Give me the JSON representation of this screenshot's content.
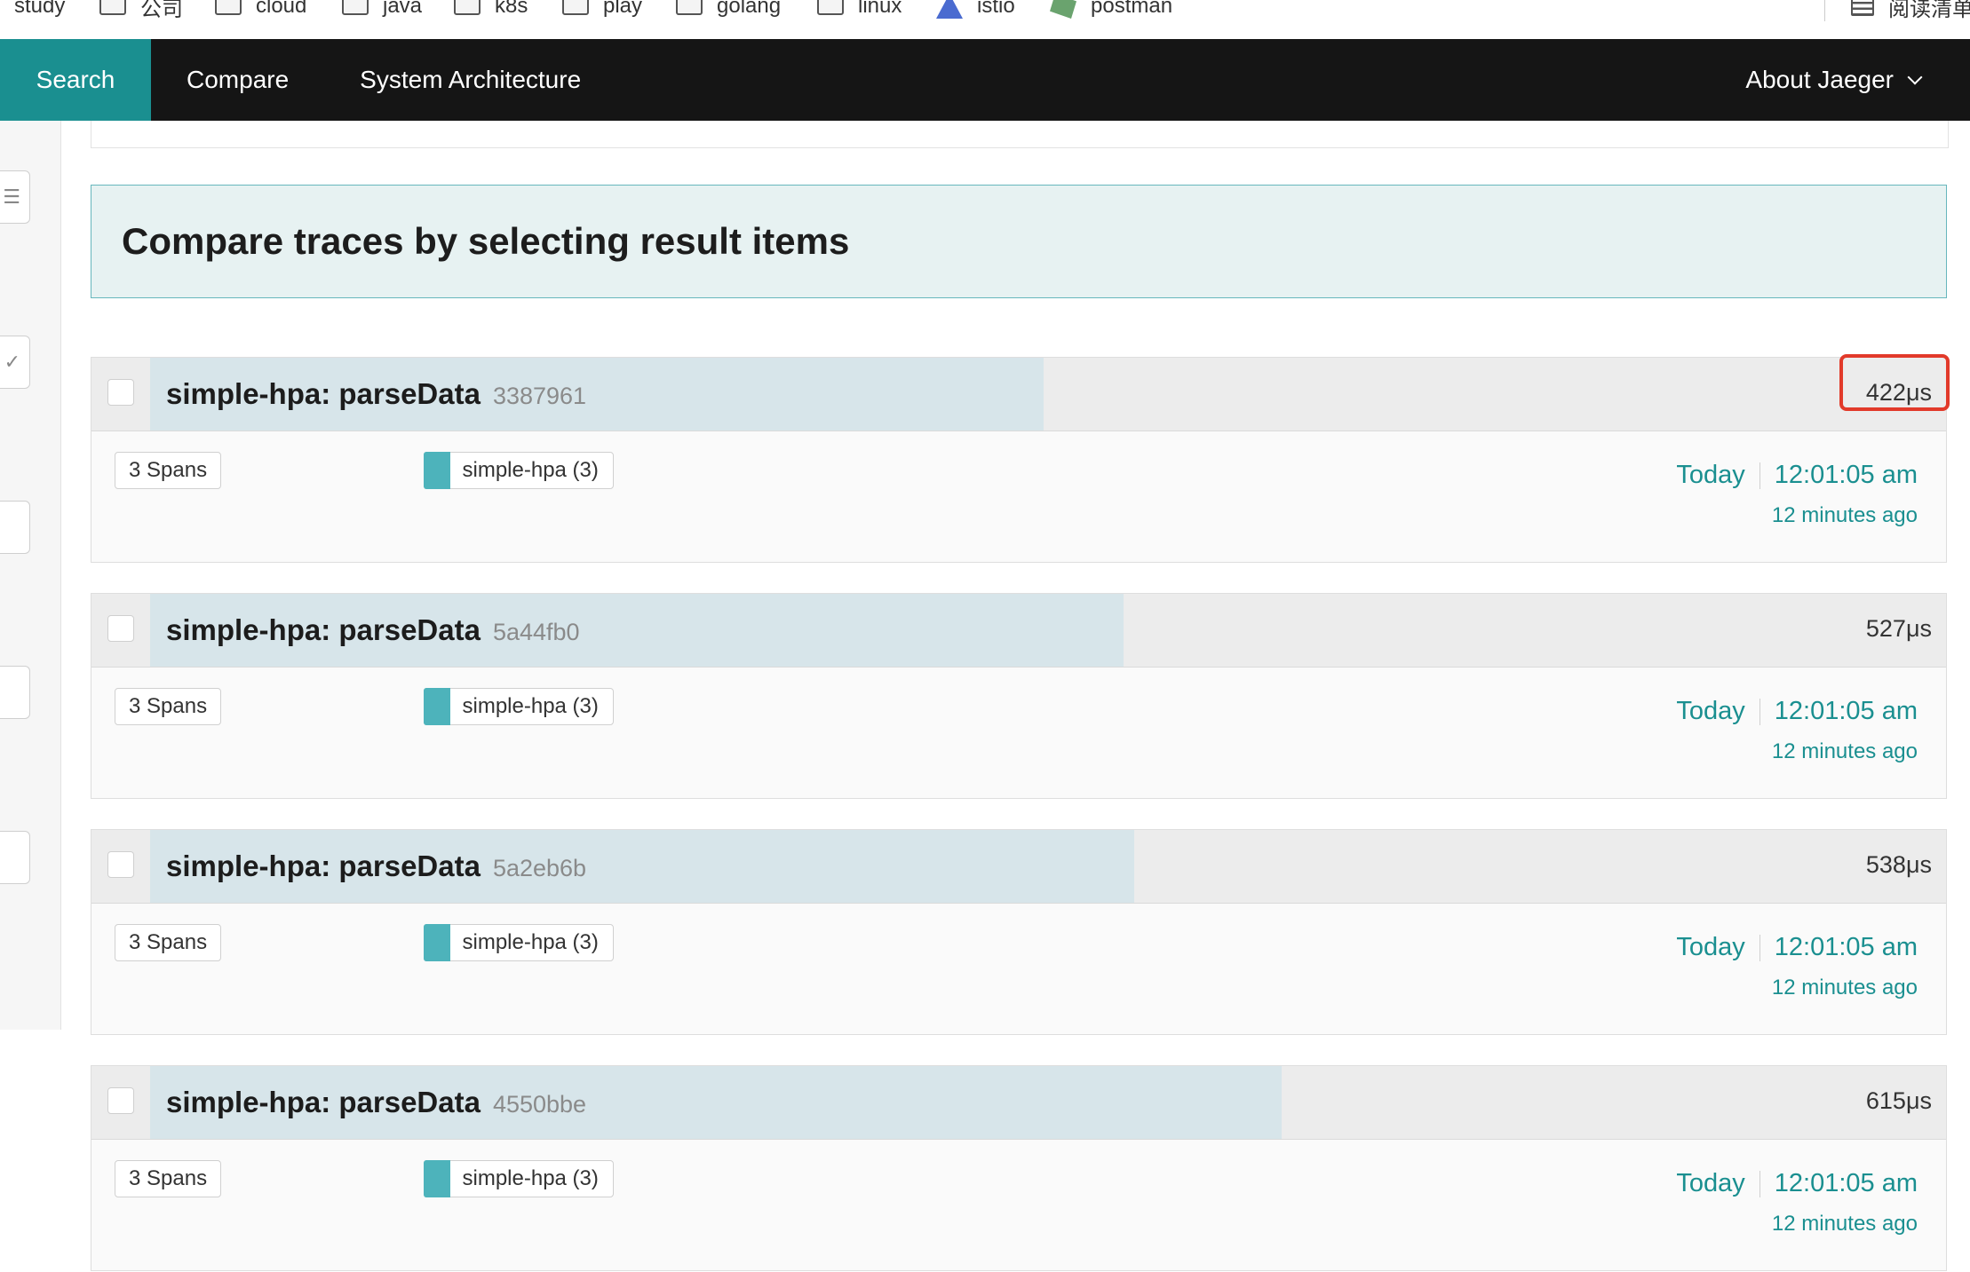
{
  "bookmarks": [
    {
      "label": "study",
      "icon": "none"
    },
    {
      "label": "公司",
      "icon": "folder-icon"
    },
    {
      "label": "cloud",
      "icon": "folder-icon"
    },
    {
      "label": "java",
      "icon": "folder-icon"
    },
    {
      "label": "k8s",
      "icon": "folder-icon"
    },
    {
      "label": "play",
      "icon": "folder-icon"
    },
    {
      "label": "golang",
      "icon": "folder-icon"
    },
    {
      "label": "linux",
      "icon": "folder-icon"
    },
    {
      "label": "istio",
      "icon": "istio-icon"
    },
    {
      "label": "postman",
      "icon": "postman-icon"
    },
    {
      "label": "阅读清单",
      "icon": "reading-list-icon"
    }
  ],
  "nav": {
    "search": "Search",
    "compare": "Compare",
    "architecture": "System Architecture",
    "about": "About Jaeger"
  },
  "banner": {
    "title": "Compare traces by selecting result items"
  },
  "colors": {
    "accent": "#1a8f90",
    "service": "#4db3bb",
    "highlight": "#e23a2a",
    "nav_bg": "#151515"
  },
  "traces": [
    {
      "title": "simple-hpa: parseData",
      "id": "3387961",
      "duration": "422μs",
      "duration_fraction": 0.79,
      "spans": "3 Spans",
      "service": "simple-hpa (3)",
      "day": "Today",
      "time": "12:01:05 am",
      "ago": "12 minutes ago",
      "highlighted": true
    },
    {
      "title": "simple-hpa: parseData",
      "id": "5a44fb0",
      "duration": "527μs",
      "duration_fraction": 0.86,
      "spans": "3 Spans",
      "service": "simple-hpa (3)",
      "day": "Today",
      "time": "12:01:05 am",
      "ago": "12 minutes ago",
      "highlighted": false
    },
    {
      "title": "simple-hpa: parseData",
      "id": "5a2eb6b",
      "duration": "538μs",
      "duration_fraction": 0.87,
      "spans": "3 Spans",
      "service": "simple-hpa (3)",
      "day": "Today",
      "time": "12:01:05 am",
      "ago": "12 minutes ago",
      "highlighted": false
    },
    {
      "title": "simple-hpa: parseData",
      "id": "4550bbe",
      "duration": "615μs",
      "duration_fraction": 1.0,
      "spans": "3 Spans",
      "service": "simple-hpa (3)",
      "day": "Today",
      "time": "12:01:05 am",
      "ago": "12 minutes ago",
      "highlighted": false
    }
  ]
}
